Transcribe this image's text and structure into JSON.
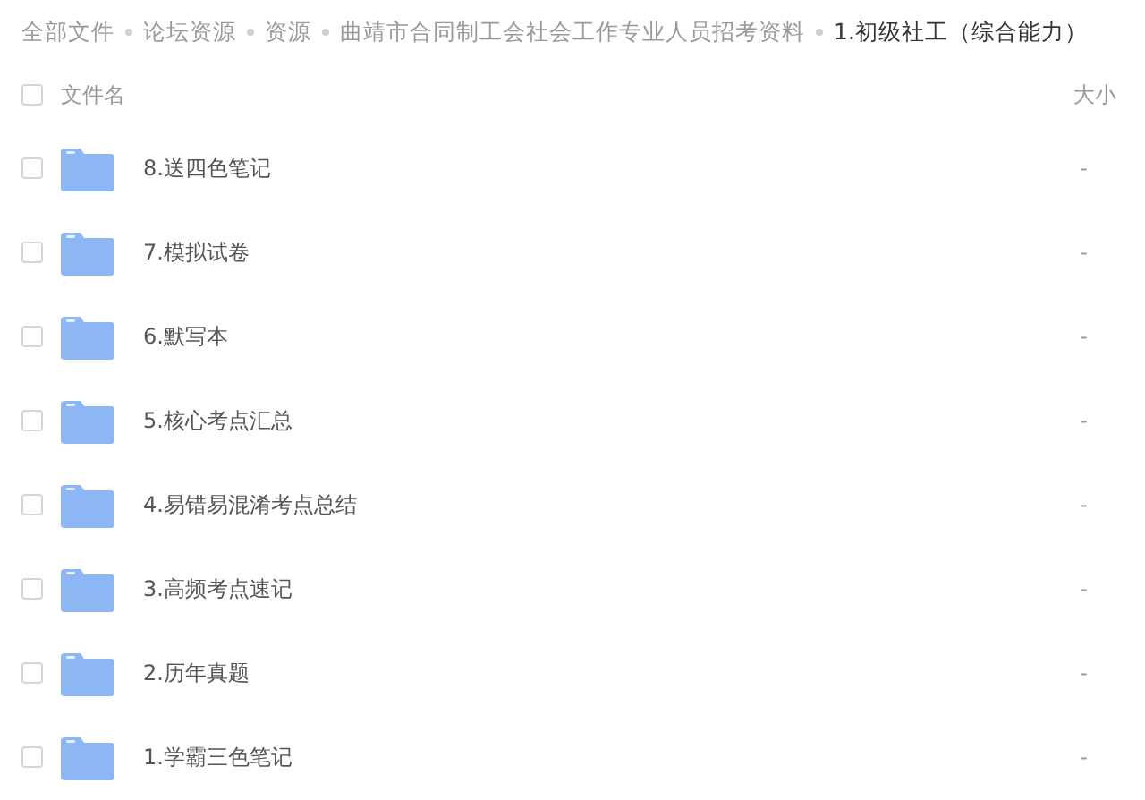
{
  "breadcrumb": [
    {
      "label": "全部文件",
      "current": false
    },
    {
      "label": "论坛资源",
      "current": false
    },
    {
      "label": "资源",
      "current": false
    },
    {
      "label": "曲靖市合同制工会社会工作专业人员招考资料",
      "current": false
    },
    {
      "label": "1.初级社工（综合能力）",
      "current": true
    }
  ],
  "table": {
    "select_all": {
      "checked": false
    },
    "columns": [
      "文件名",
      "大小"
    ],
    "rows": [
      {
        "name": "8.送四色笔记",
        "size": "-",
        "checked": false
      },
      {
        "name": "7.模拟试卷",
        "size": "-",
        "checked": false
      },
      {
        "name": "6.默写本",
        "size": "-",
        "checked": false
      },
      {
        "name": "5.核心考点汇总",
        "size": "-",
        "checked": false
      },
      {
        "name": "4.易错易混淆考点总结",
        "size": "-",
        "checked": false
      },
      {
        "name": "3.高频考点速记",
        "size": "-",
        "checked": false
      },
      {
        "name": "2.历年真题",
        "size": "-",
        "checked": false
      },
      {
        "name": "1.学霸三色笔记",
        "size": "-",
        "checked": false
      }
    ]
  }
}
